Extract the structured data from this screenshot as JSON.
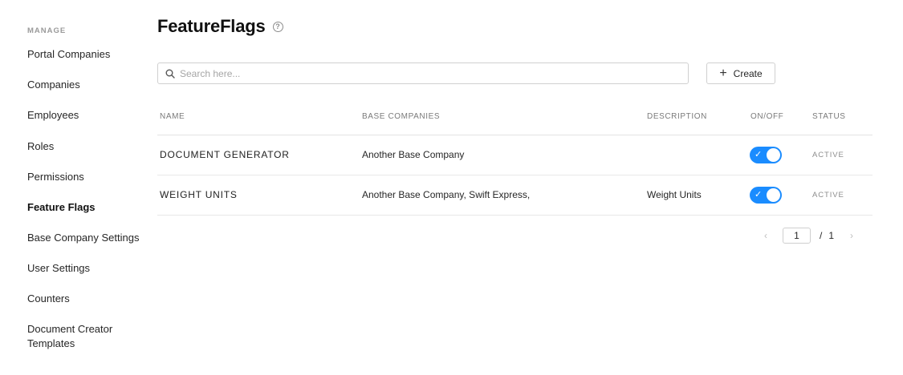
{
  "sidebar": {
    "section_label": "MANAGE",
    "items": [
      {
        "label": "Portal Companies"
      },
      {
        "label": "Companies"
      },
      {
        "label": "Employees"
      },
      {
        "label": "Roles"
      },
      {
        "label": "Permissions"
      },
      {
        "label": "Feature Flags",
        "active": true
      },
      {
        "label": "Base Company Settings"
      },
      {
        "label": "User Settings"
      },
      {
        "label": "Counters"
      },
      {
        "label": "Document Creator Templates"
      }
    ]
  },
  "header": {
    "title": "FeatureFlags",
    "help_icon": "question-circle-icon"
  },
  "toolbar": {
    "search_placeholder": "Search here...",
    "search_value": "",
    "create_label": "Create"
  },
  "table": {
    "columns": [
      "NAME",
      "BASE COMPANIES",
      "DESCRIPTION",
      "ON/OFF",
      "STATUS"
    ],
    "rows": [
      {
        "name": "DOCUMENT GENERATOR",
        "base_companies": "Another Base Company",
        "description": "",
        "enabled": true,
        "toggle_symbol": "✓",
        "status": "ACTIVE"
      },
      {
        "name": "WEIGHT UNITS",
        "base_companies": "Another Base Company, Swift Express,",
        "description": "Weight Units",
        "enabled": true,
        "toggle_symbol": "✓",
        "status": "ACTIVE"
      }
    ]
  },
  "pagination": {
    "current_page": "1",
    "separator": "/",
    "total_pages": "1",
    "prev_symbol": "‹",
    "next_symbol": "›"
  },
  "colors": {
    "toggle_on": "#1a8cff",
    "text_primary": "#1f1f1f",
    "text_muted": "#8c8c8c"
  }
}
